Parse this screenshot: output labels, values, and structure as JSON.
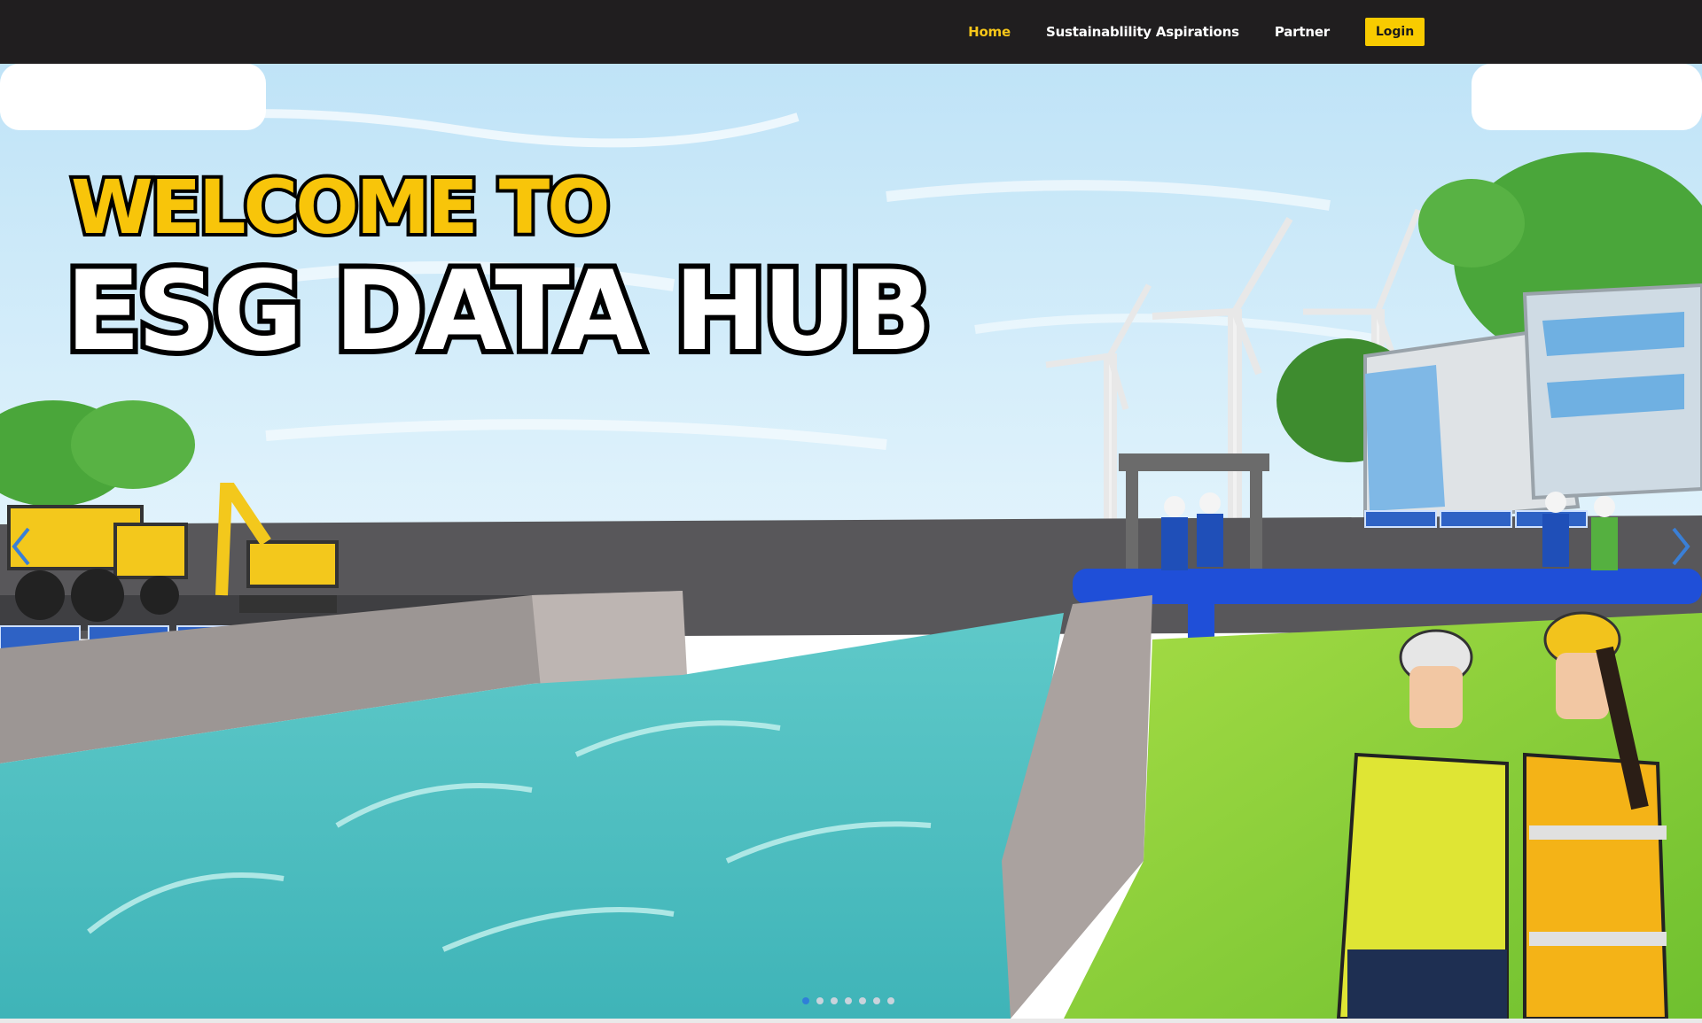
{
  "nav": {
    "links": [
      {
        "label": "Home",
        "active": true
      },
      {
        "label": "Sustainablility Aspirations",
        "active": false
      },
      {
        "label": "Partner",
        "active": false
      }
    ],
    "login_label": "Login",
    "accent_color": "#f8cb00",
    "active_color": "#f6c619"
  },
  "hero": {
    "welcome": "WELCOME TO",
    "title": "ESG DATA HUB",
    "carousel": {
      "slide_count": 7,
      "active_index": 0
    },
    "prev_icon": "chevron-left-icon",
    "next_icon": "chevron-right-icon"
  }
}
